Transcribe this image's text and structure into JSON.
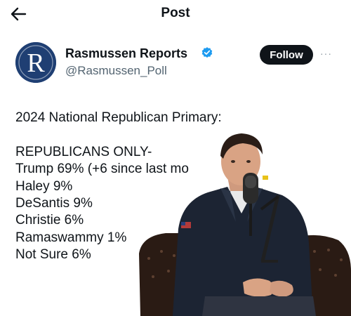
{
  "header": {
    "title": "Post"
  },
  "author": {
    "display_name": "Rasmussen Reports",
    "handle": "@Rasmussen_Poll",
    "avatar_letter": "R",
    "follow_label": "Follow",
    "more_label": "···"
  },
  "tweet": {
    "line1": "2024 National Republican Primary:",
    "line2": "REPUBLICANS ONLY-",
    "line3": "Trump 69% (+6 since last mo",
    "line4": "Haley 9%",
    "line5": "DeSantis 9%",
    "line6": "Christie 6%",
    "line7": "Ramaswammy 1%",
    "line8": "Not Sure 6%"
  },
  "icons": {
    "back": "arrow-left-icon",
    "verified": "verified-badge-icon",
    "more": "more-dots-icon"
  },
  "colors": {
    "verified_blue": "#1d9bf0",
    "follow_bg": "#0f1419",
    "avatar_bg": "#1f3f73"
  }
}
